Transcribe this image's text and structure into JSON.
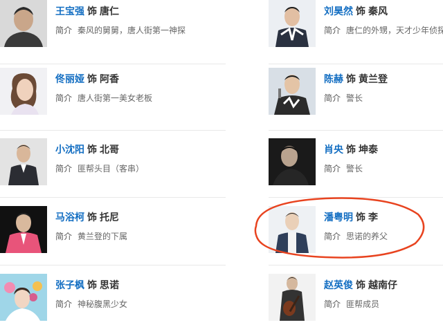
{
  "label_separator": "饰",
  "desc_label": "简介",
  "cast": [
    {
      "actor": "王宝强",
      "role": "唐仁",
      "desc": "秦风的舅舅，唐人街第一神探",
      "photo": "headshot-man-expressive"
    },
    {
      "actor": "刘昊然",
      "role": "秦风",
      "desc": "唐仁的外甥，天才少年侦探",
      "photo": "headshot-young-man-jacket"
    },
    {
      "actor": "佟丽娅",
      "role": "阿香",
      "desc": "唐人街第一美女老板",
      "photo": "headshot-woman-smiling"
    },
    {
      "actor": "陈赫",
      "role": "黄兰登",
      "desc": "警长",
      "photo": "headshot-man-microphone"
    },
    {
      "actor": "小沈阳",
      "role": "北哥",
      "desc": "匪帮头目（客串）",
      "photo": "headshot-man-suit"
    },
    {
      "actor": "肖央",
      "role": "坤泰",
      "desc": "警长",
      "photo": "headshot-man-dark"
    },
    {
      "actor": "马浴柯",
      "role": "托尼",
      "desc": "黄兰登的下属",
      "photo": "headshot-man-pink-suit"
    },
    {
      "actor": "潘粤明",
      "role": "李",
      "desc": "思诺的养父",
      "photo": "headshot-man-vest"
    },
    {
      "actor": "张子枫",
      "role": "思诺",
      "desc": "神秘腹黑少女",
      "photo": "headshot-girl-flowers"
    },
    {
      "actor": "赵英俊",
      "role": "越南仔",
      "desc": "匪帮成员",
      "photo": "headshot-man-guitar"
    }
  ],
  "colors": {
    "actor_link": "#136ec2",
    "annotation_circle": "#e8431f",
    "divider": "#e8e8e8"
  }
}
